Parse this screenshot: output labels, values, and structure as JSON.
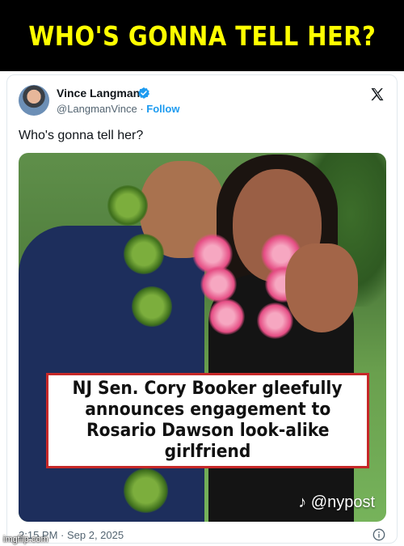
{
  "meme": {
    "caption": "WHO'S GONNA TELL HER?"
  },
  "tweet": {
    "author": {
      "display_name": "Vince Langman",
      "handle": "@LangmanVince",
      "separator": "·",
      "follow_label": "Follow",
      "verified": true
    },
    "text": "Who's gonna tell her?",
    "media": {
      "headline": [
        "NJ Sen. Cory Booker gleefully",
        "announces engagement to",
        "Rosario Dawson look-alike",
        "girlfriend"
      ],
      "watermark": "@nypost"
    },
    "timestamp": "2:15 PM · Sep 2, 2025"
  },
  "site_watermark": "imgflip.com",
  "icons": {
    "verified": "verified-badge-icon",
    "platform": "x-logo-icon",
    "info": "info-icon",
    "tiktok": "tiktok-icon"
  },
  "colors": {
    "banner_bg": "#000000",
    "caption": "#ffff00",
    "link_blue": "#1d9bf0",
    "headline_border": "#c62828"
  }
}
